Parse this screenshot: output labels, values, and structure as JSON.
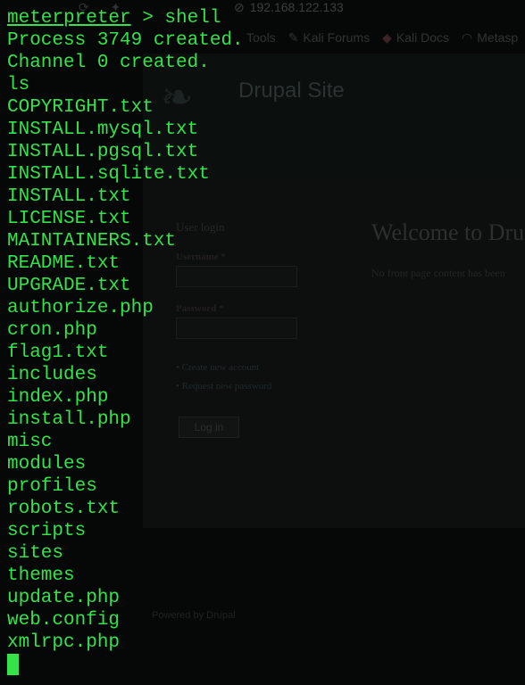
{
  "background_browser": {
    "url": "192.168.122.133",
    "bookmarks": [
      "Tools",
      "Kali Forums",
      "Kali Docs",
      "Metasp"
    ],
    "site_title": "Drupal Site",
    "login": {
      "title": "User login",
      "username_label": "Username *",
      "password_label": "Password *",
      "links": [
        "Create new account",
        "Request new password"
      ],
      "button": "Log in"
    },
    "welcome_title": "Welcome to Dru",
    "welcome_text": "No front page content has been",
    "footer": "Powered by Drupal"
  },
  "terminal": {
    "prompt": "meterpreter",
    "prompt_suffix": " > shell",
    "output": [
      "Process 3749 created.",
      "Channel 0 created.",
      "ls",
      "COPYRIGHT.txt",
      "INSTALL.mysql.txt",
      "INSTALL.pgsql.txt",
      "INSTALL.sqlite.txt",
      "INSTALL.txt",
      "LICENSE.txt",
      "MAINTAINERS.txt",
      "README.txt",
      "UPGRADE.txt",
      "authorize.php",
      "cron.php",
      "flag1.txt",
      "includes",
      "index.php",
      "install.php",
      "misc",
      "modules",
      "profiles",
      "robots.txt",
      "scripts",
      "sites",
      "themes",
      "update.php",
      "web.config",
      "xmlrpc.php"
    ],
    "text_color": "#34e24a",
    "background_color": "#060807"
  }
}
